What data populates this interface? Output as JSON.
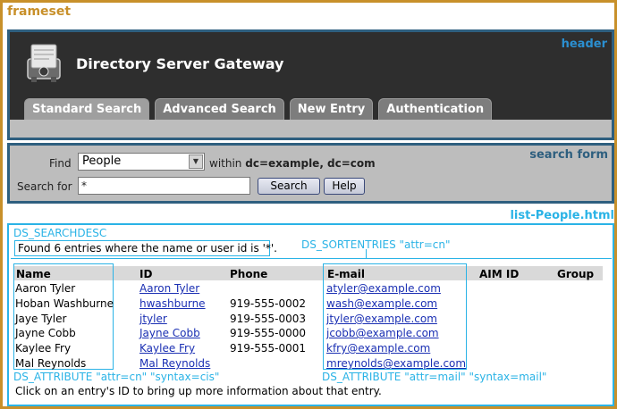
{
  "frameset": {
    "label": "frameset"
  },
  "header": {
    "label": "header",
    "app_title": "Directory Server Gateway",
    "tabs": [
      {
        "label": "Standard Search",
        "active": true
      },
      {
        "label": "Advanced Search",
        "active": false
      },
      {
        "label": "New Entry",
        "active": false
      },
      {
        "label": "Authentication",
        "active": false
      }
    ],
    "logo_icon": "rolodex-icon"
  },
  "search_form": {
    "label": "search form",
    "find_label": "Find",
    "find_value": "People",
    "within_label": "within",
    "within_value": "dc=example, dc=com",
    "search_for_label": "Search for",
    "search_for_value": "*",
    "search_button": "Search",
    "help_button": "Help"
  },
  "list": {
    "label": "list-People.html",
    "searchdesc_tag": "DS_SEARCHDESC",
    "searchdesc_text": "Found 6 entries where the name or user id is '*'.",
    "sortentries_tag": "DS_SORTENTRIES \"attr=cn\"",
    "columns": [
      "Name",
      "ID",
      "Phone",
      "E-mail",
      "AIM ID",
      "Group"
    ],
    "rows": [
      {
        "name": "Aaron Tyler",
        "id": "Aaron Tyler",
        "phone": "",
        "email": "atyler@example.com"
      },
      {
        "name": "Hoban Washburne",
        "id": "hwashburne",
        "phone": "919-555-0002",
        "email": "wash@example.com"
      },
      {
        "name": "Jaye Tyler",
        "id": "jtyler",
        "phone": "919-555-0003",
        "email": "jtyler@example.com"
      },
      {
        "name": "Jayne Cobb",
        "id": "Jayne Cobb",
        "phone": "919-555-0000",
        "email": "jcobb@example.com"
      },
      {
        "name": "Kaylee Fry",
        "id": "Kaylee Fry",
        "phone": "919-555-0001",
        "email": "kfry@example.com"
      },
      {
        "name": "Mal Reynolds",
        "id": "Mal Reynolds",
        "phone": "",
        "email": "mreynolds@example.com"
      }
    ],
    "attr_cn_tag": "DS_ATTRIBUTE \"attr=cn\" \"syntax=cis\"",
    "attr_mail_tag": "DS_ATTRIBUTE \"attr=mail\" \"syntax=mail\"",
    "footnote": "Click on an entry's ID to bring up more information about that entry."
  },
  "colors": {
    "frameset_border": "#c8902a",
    "header_border": "#2e5f7f",
    "annotation_blue": "#2ab3e6",
    "link_blue": "#1a2fb3"
  }
}
